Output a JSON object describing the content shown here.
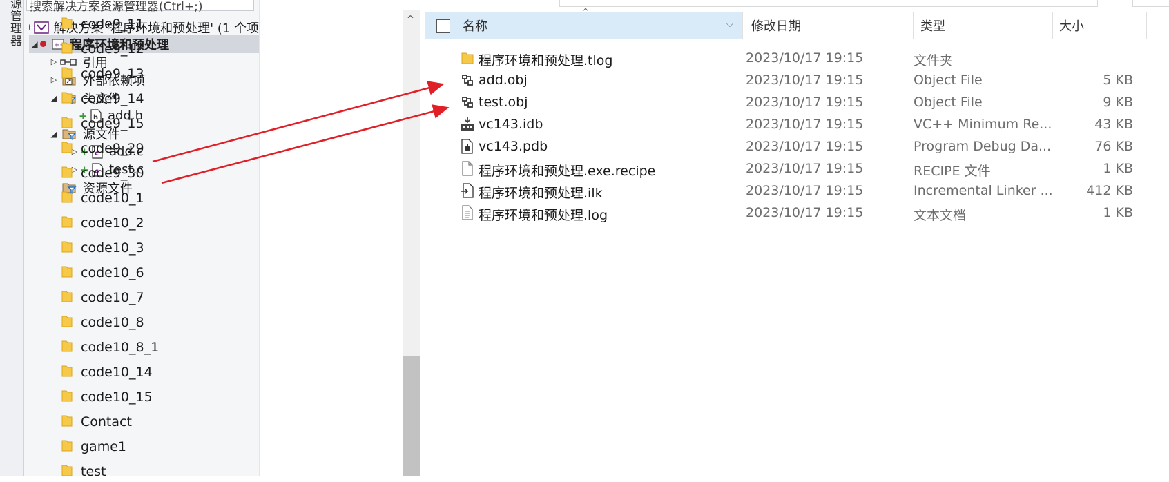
{
  "solution_explorer": {
    "side_tab": "源管理器",
    "search_placeholder": "搜索解决方案资源管理器(Ctrl+;)",
    "solution_label": "解决方案 '程序环境和预处理' (1 个项",
    "project_label": "程序环境和预处理",
    "nodes": {
      "references": "引用",
      "external_deps": "外部依赖项",
      "header_files": "头文件",
      "add_h": "add.h",
      "source_files": "源文件",
      "add_c": "add.c",
      "test_c": "test.c",
      "resource_files": "资源文件"
    }
  },
  "nav_folders": [
    "code9_11",
    "code9_12",
    "code9_13",
    "code9_14",
    "code9_15",
    "code9_29",
    "code9_30",
    "code10_1",
    "code10_2",
    "code10_3",
    "code10_6",
    "code10_7",
    "code10_8",
    "code10_8_1",
    "code10_14",
    "code10_15",
    "Contact",
    "game1",
    "test"
  ],
  "columns": {
    "name": "名称",
    "date": "修改日期",
    "type": "类型",
    "size": "大小"
  },
  "files": [
    {
      "name": "程序环境和预处理.tlog",
      "date": "2023/10/17 19:15",
      "type": "文件夹",
      "size": "",
      "icon": "folder-icon"
    },
    {
      "name": "add.obj",
      "date": "2023/10/17 19:15",
      "type": "Object File",
      "size": "5 KB",
      "icon": "object-file-icon"
    },
    {
      "name": "test.obj",
      "date": "2023/10/17 19:15",
      "type": "Object File",
      "size": "9 KB",
      "icon": "object-file-icon"
    },
    {
      "name": "vc143.idb",
      "date": "2023/10/17 19:15",
      "type": "VC++ Minimum Re...",
      "size": "43 KB",
      "icon": "idb-file-icon"
    },
    {
      "name": "vc143.pdb",
      "date": "2023/10/17 19:15",
      "type": "Program Debug Da...",
      "size": "76 KB",
      "icon": "pdb-file-icon"
    },
    {
      "name": "程序环境和预处理.exe.recipe",
      "date": "2023/10/17 19:15",
      "type": "RECIPE 文件",
      "size": "1 KB",
      "icon": "blank-file-icon"
    },
    {
      "name": "程序环境和预处理.ilk",
      "date": "2023/10/17 19:15",
      "type": "Incremental Linker ...",
      "size": "412 KB",
      "icon": "ilk-file-icon"
    },
    {
      "name": "程序环境和预处理.log",
      "date": "2023/10/17 19:15",
      "type": "文本文档",
      "size": "1 KB",
      "icon": "text-file-icon"
    }
  ],
  "annotation_color": "#e01f26"
}
